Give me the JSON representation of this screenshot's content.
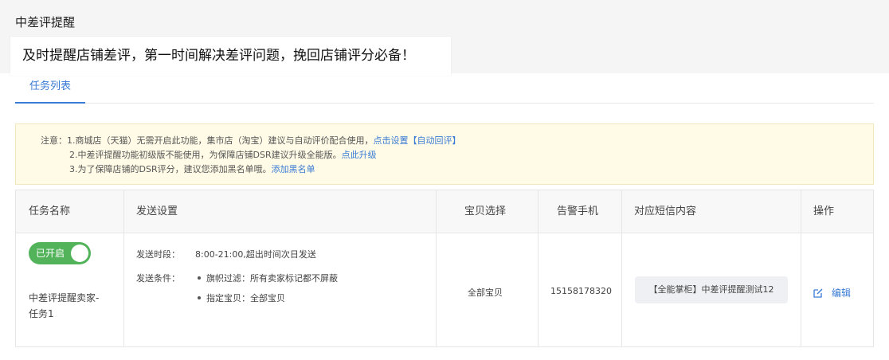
{
  "page": {
    "title": "中差评提醒",
    "banner": "及时提醒店铺差评，第一时间解决差评问题，挽回店铺评分必备！"
  },
  "tabs": [
    {
      "label": "任务列表",
      "active": true
    }
  ],
  "notice": {
    "prefix": "注意：",
    "line1_text": "1.商城店（天猫）无需开启此功能，集市店（淘宝）建议与自动评价配合使用，",
    "line1_link": "点击设置【自动回评】",
    "line2_text": "2.中差评提醒功能初级版不能使用，为保障店铺DSR建议升级全能版。",
    "line2_link": "点此升级",
    "line3_text": "3.为了保障店铺的DSR评分，建议您添加黑名单哦。",
    "line3_link": "添加黑名单"
  },
  "table": {
    "headers": {
      "task_name": "任务名称",
      "send_settings": "发送设置",
      "product_select": "宝贝选择",
      "alert_phone": "告警手机",
      "sms_content": "对应短信内容",
      "actions": "操作"
    },
    "row": {
      "toggle_label": "已开启",
      "toggle_on": true,
      "task_name_line1": "中差评提醒卖家-",
      "task_name_line2": "任务1",
      "send_time_label": "发送时段：",
      "send_time_value": "8:00-21:00,超出时间次日发送",
      "send_cond_label": "发送条件：",
      "cond_1": "旗帜过滤：所有卖家标记都不屏蔽",
      "cond_2": "指定宝贝：全部宝贝",
      "products": "全部宝贝",
      "phone": "15158178320",
      "sms": "【全能掌柜】中差评提醒测试12",
      "edit_label": "编辑"
    }
  },
  "colors": {
    "accent": "#3a7bd5",
    "toggle_on": "#52b35a",
    "notice_bg": "#fffbe6"
  },
  "icons": {
    "edit": "edit-icon"
  }
}
